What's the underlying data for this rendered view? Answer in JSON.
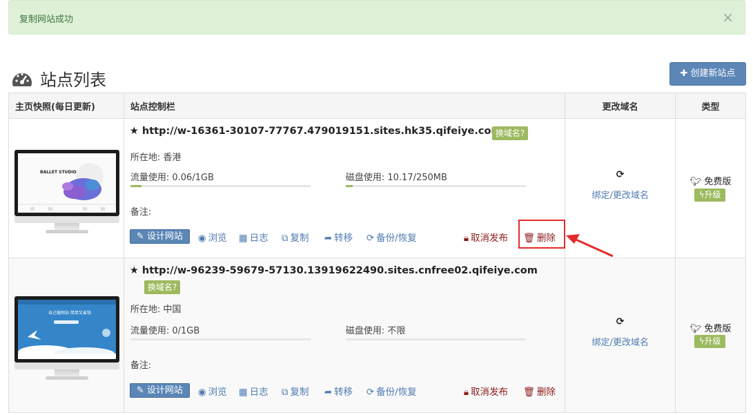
{
  "alert": {
    "message": "复制网站成功",
    "close": "×"
  },
  "header": {
    "title": "站点列表",
    "create_button": "创建新站点",
    "create_icon": "plus-icon"
  },
  "table": {
    "columns": [
      "主页快照(每日更新)",
      "站点控制栏",
      "更改域名",
      "类型"
    ],
    "rows": [
      {
        "url": "http://w-16361-30107-77767.479019151.sites.hk35.qifeiye.com",
        "domain_badge": "换域名?",
        "location": "所在地: 香港",
        "traffic": "流量使用: 0.06/1GB",
        "traffic_fraction": 0.06,
        "disk": "磁盘使用: 10.17/250MB",
        "disk_fraction": 0.0407,
        "notes": "备注:",
        "thumb_text": "BALLET STUDIO",
        "actions": {
          "design": "设计网站",
          "browse": "浏览",
          "log": "日志",
          "copy": "复制",
          "transfer": "转移",
          "backup": "备份/恢复",
          "unpublish": "取消发布",
          "delete": "删除"
        },
        "bind_domain": "绑定/更改域名",
        "plan": "免费版",
        "upgrade": "升级"
      },
      {
        "url": "http://w-96239-59679-57130.13919622490.sites.cnfree02.qifeiye.com",
        "domain_badge": "换域名?",
        "location": "所在地: 中国",
        "traffic": "流量使用: 0/1GB",
        "traffic_fraction": 0,
        "disk": "磁盘使用: 不限",
        "disk_fraction": 0,
        "notes": "备注:",
        "thumb_text": "自己做网站 简单又省钱",
        "actions": {
          "design": "设计网站",
          "browse": "浏览",
          "log": "日志",
          "copy": "复制",
          "transfer": "转移",
          "backup": "备份/恢复",
          "unpublish": "取消发布",
          "delete": "删除"
        },
        "bind_domain": "绑定/更改域名",
        "plan": "免费版",
        "upgrade": "升级"
      }
    ]
  },
  "colors": {
    "accent": "#5b86b6",
    "success_bg": "#dff0d8",
    "badge_green": "#9dba5f",
    "danger": "#8b1a1a",
    "highlight": "#e52b2b"
  }
}
